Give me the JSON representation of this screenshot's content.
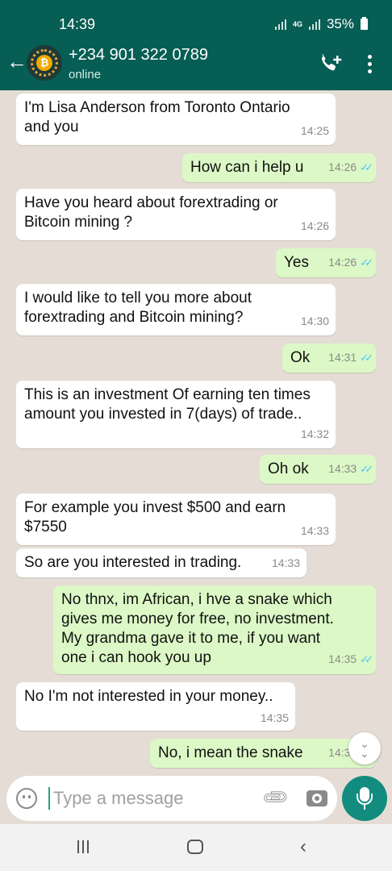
{
  "status_bar": {
    "time": "14:39",
    "network": "4G",
    "battery": "35%"
  },
  "header": {
    "contact_name": "+234 901 322 0789",
    "contact_status": "online",
    "back_icon": "arrow-left-icon",
    "call_icon": "add-call-icon",
    "menu_icon": "more-vertical-icon"
  },
  "messages": [
    {
      "dir": "in",
      "text": "I'm Lisa Anderson from Toronto Ontario\nand you",
      "time": "14:25"
    },
    {
      "dir": "out",
      "text": "How can i help u",
      "time": "14:26"
    },
    {
      "dir": "in",
      "text": "Have you heard about forextrading or\nBitcoin mining ?",
      "time": "14:26"
    },
    {
      "dir": "out",
      "text": "Yes",
      "time": "14:26"
    },
    {
      "dir": "in",
      "text": "I would like to tell you more about\nforextrading and Bitcoin mining?",
      "time": "14:30"
    },
    {
      "dir": "out",
      "text": "Ok",
      "time": "14:31"
    },
    {
      "dir": "in",
      "text": "This is an investment Of earning ten times\namount you invested in 7(days) of trade..",
      "time": "14:32"
    },
    {
      "dir": "out",
      "text": "Oh ok",
      "time": "14:33"
    },
    {
      "dir": "in",
      "text": "For example you invest $500 and earn\n$7550",
      "time": "14:33"
    },
    {
      "dir": "in",
      "text": "So are you interested in trading.",
      "time": "14:33"
    },
    {
      "dir": "out",
      "text": "No thnx, im African, i hve a snake which\ngives me money for free, no investment.\nMy grandma gave it to me, if you want\none i can hook you up",
      "time": "14:35"
    },
    {
      "dir": "in",
      "text": "No I'm not interested in your money..",
      "time": "14:35"
    },
    {
      "dir": "out",
      "text": "No, i mean the snake",
      "time": "14:36"
    }
  ],
  "composer": {
    "placeholder": "Type a message"
  },
  "colors": {
    "header": "#075e54",
    "outgoing": "#dcf8c6",
    "incoming": "#ffffff",
    "background": "#e5ddd5",
    "tick": "#4fc3f7",
    "mic_button": "#128c7e"
  }
}
